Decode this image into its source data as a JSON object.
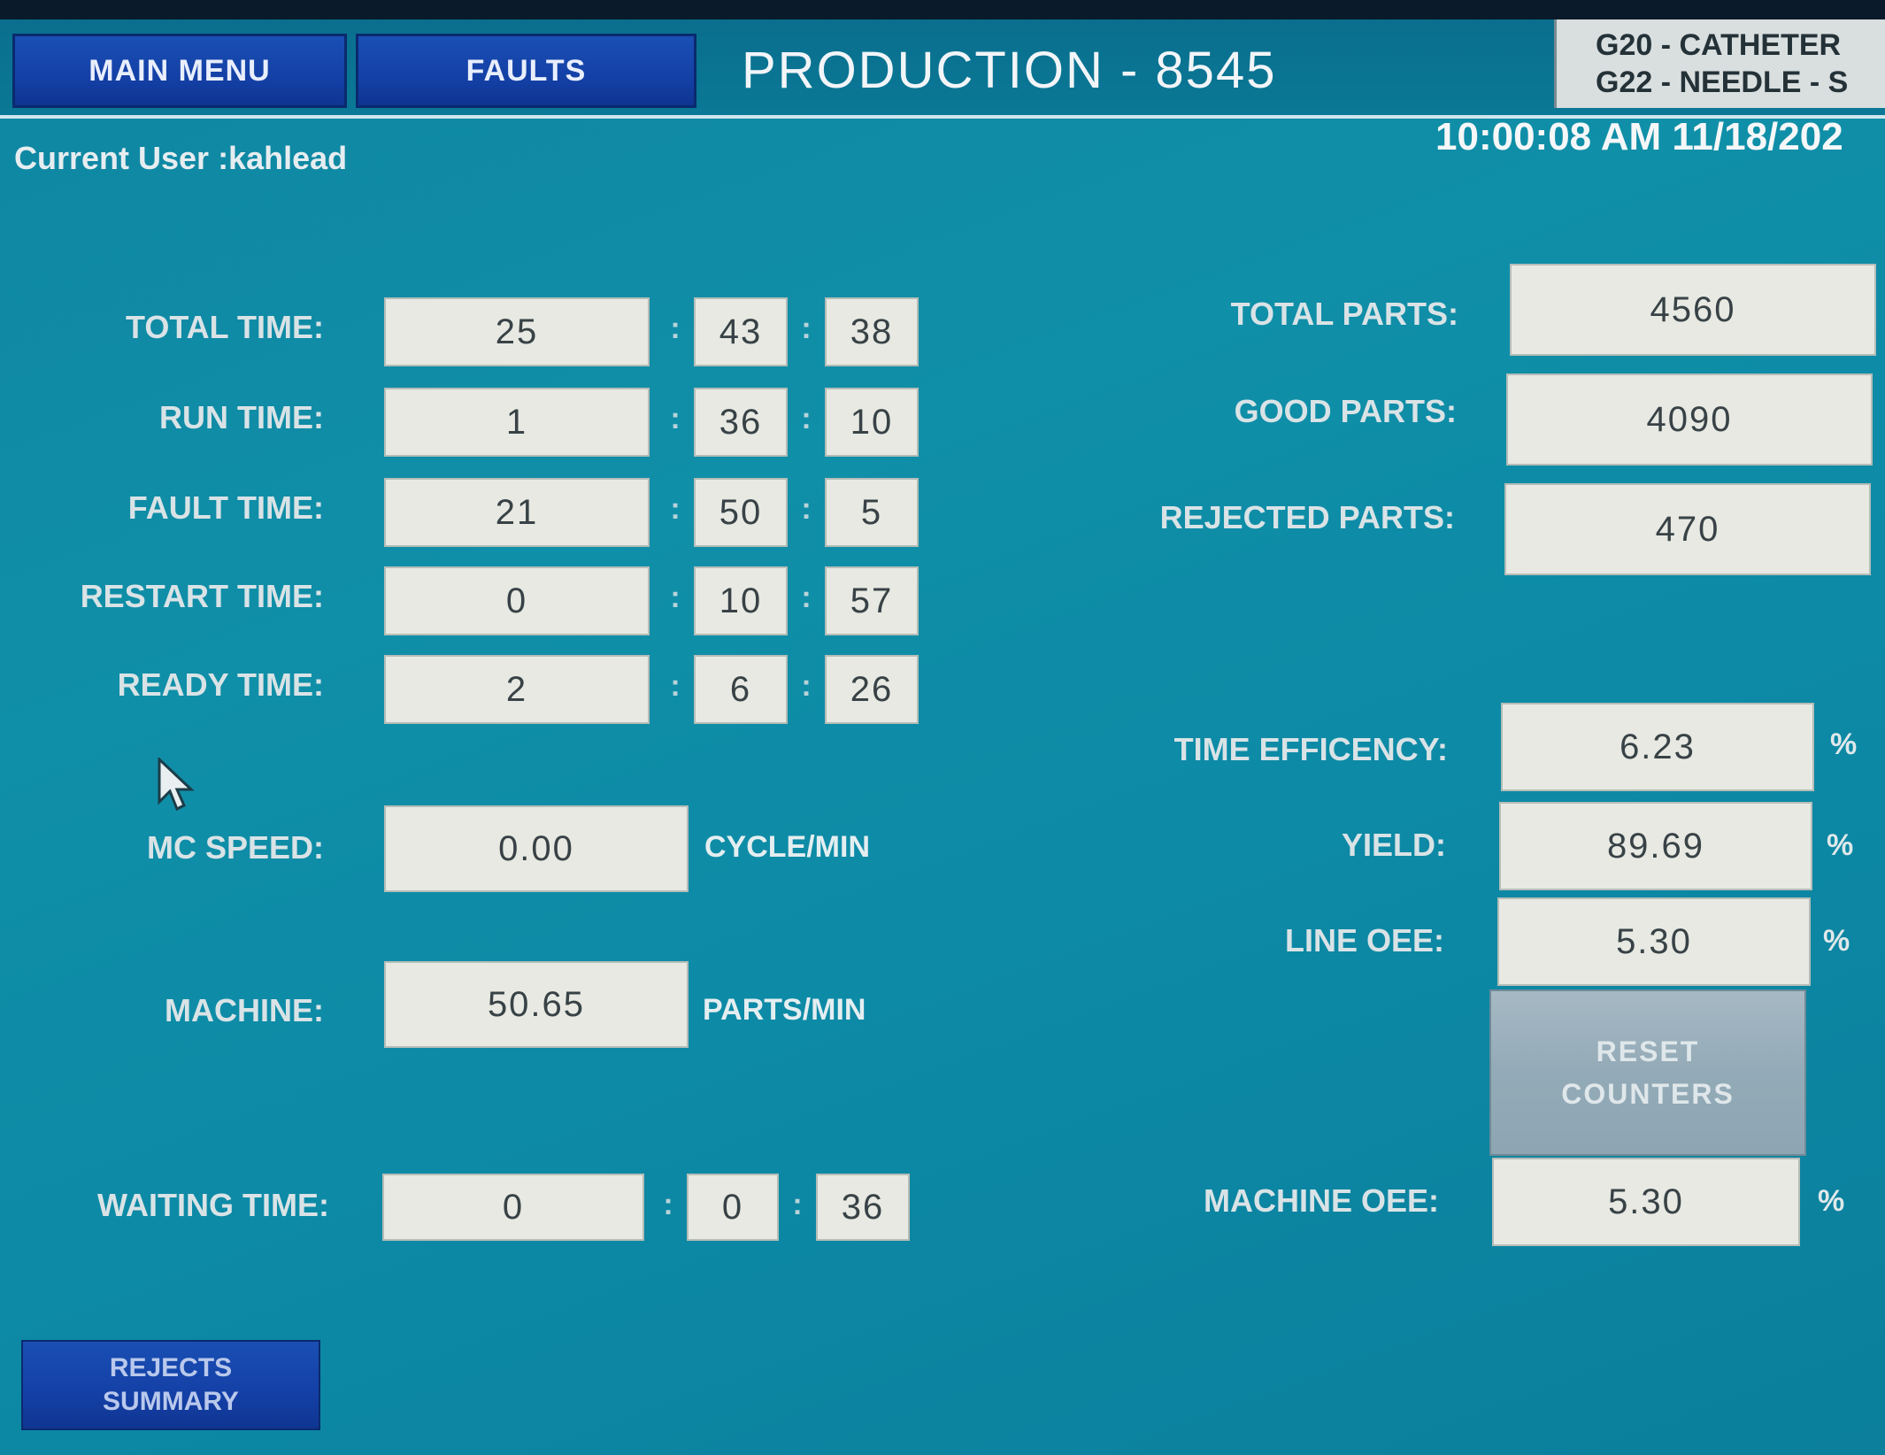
{
  "nav": {
    "main_menu": "MAIN MENU",
    "faults": "FAULTS"
  },
  "title": "PRODUCTION - 8545",
  "product": {
    "line1": "G20 - CATHETER",
    "line2": "G22 - NEEDLE - S"
  },
  "current_user": "Current User :kahlead",
  "datetime": "10:00:08 AM 11/18/202",
  "times": [
    {
      "label": "TOTAL TIME:",
      "h": "25",
      "m": "43",
      "s": "38"
    },
    {
      "label": "RUN TIME:",
      "h": "1",
      "m": "36",
      "s": "10"
    },
    {
      "label": "FAULT TIME:",
      "h": "21",
      "m": "50",
      "s": "5"
    },
    {
      "label": "RESTART TIME:",
      "h": "0",
      "m": "10",
      "s": "57"
    },
    {
      "label": "READY TIME:",
      "h": "2",
      "m": "6",
      "s": "26"
    }
  ],
  "mc_speed": {
    "label": "MC SPEED:",
    "value": "0.00",
    "unit": "CYCLE/MIN"
  },
  "machine": {
    "label": "MACHINE:",
    "value": "50.65",
    "unit": "PARTS/MIN"
  },
  "waiting": {
    "label": "WAITING TIME:",
    "h": "0",
    "m": "0",
    "s": "36"
  },
  "parts": {
    "total": {
      "label": "TOTAL PARTS:",
      "value": "4560"
    },
    "good": {
      "label": "GOOD PARTS:",
      "value": "4090"
    },
    "rejected": {
      "label": "REJECTED PARTS:",
      "value": "470"
    }
  },
  "metrics": {
    "time_eff": {
      "label": "TIME EFFICENCY:",
      "value": "6.23",
      "unit": "%"
    },
    "yield": {
      "label": "YIELD:",
      "value": "89.69",
      "unit": "%"
    },
    "line_oee": {
      "label": "LINE OEE:",
      "value": "5.30",
      "unit": "%"
    },
    "machine_oee": {
      "label": "MACHINE OEE:",
      "value": "5.30",
      "unit": "%"
    }
  },
  "reset": {
    "line1": "RESET",
    "line2": "COUNTERS"
  },
  "rejects_summary": {
    "line1": "REJECTS",
    "line2": "SUMMARY"
  },
  "colon": ":",
  "icons": {
    "cursor": "mouse-pointer-icon"
  },
  "colors": {
    "background": "#0f86a2",
    "nav_button": "#1440a6",
    "field": "#e7e9e2"
  }
}
